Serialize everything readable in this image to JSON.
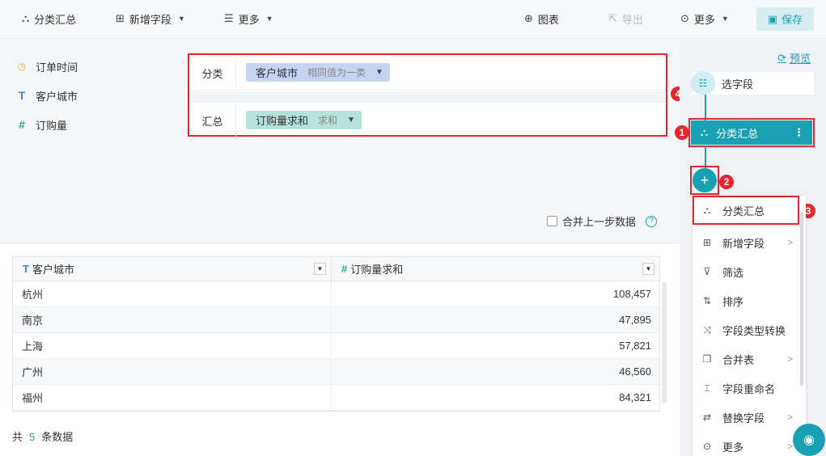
{
  "toolbar": {
    "summary": "分类汇总",
    "add_field": "新增字段",
    "more_left": "更多",
    "chart": "图表",
    "export": "导出",
    "more_right": "更多",
    "save": "保存"
  },
  "fields": [
    {
      "label": "订单时间",
      "icon": "clock-icon"
    },
    {
      "label": "客户城市",
      "icon": "text-type-icon"
    },
    {
      "label": "订购量",
      "icon": "number-type-icon"
    }
  ],
  "config": {
    "group_label": "分类",
    "group_chip": "客户城市",
    "group_sub": "相同值为一类",
    "summary_label": "汇总",
    "summary_chip": "订购量求和",
    "summary_sub": "求和"
  },
  "merge_label": "合并上一步数据",
  "table": {
    "col1": "客户城市",
    "col2": "订购量求和",
    "rows": [
      {
        "city": "杭州",
        "value": "108,457"
      },
      {
        "city": "南京",
        "value": "47,895"
      },
      {
        "city": "上海",
        "value": "57,821"
      },
      {
        "city": "广州",
        "value": "46,560"
      },
      {
        "city": "福州",
        "value": "84,321"
      }
    ],
    "total_prefix": "共",
    "total_count": "5",
    "total_suffix": "条数据"
  },
  "flow": {
    "preview": "预览",
    "select_step": "选字段",
    "active_step": "分类汇总"
  },
  "badges": [
    "1",
    "2",
    "3",
    "4"
  ],
  "menu": [
    {
      "label": "分类汇总",
      "arrow": false
    },
    {
      "label": "新增字段",
      "arrow": true
    },
    {
      "label": "筛选",
      "arrow": false
    },
    {
      "label": "排序",
      "arrow": false
    },
    {
      "label": "字段类型转换",
      "arrow": false
    },
    {
      "label": "合并表",
      "arrow": true
    },
    {
      "label": "字段重命名",
      "arrow": false
    },
    {
      "label": "替换字段",
      "arrow": true
    },
    {
      "label": "更多",
      "arrow": true
    }
  ],
  "colors": {
    "accent": "#1aa0b3",
    "highlight": "#e5262e"
  }
}
